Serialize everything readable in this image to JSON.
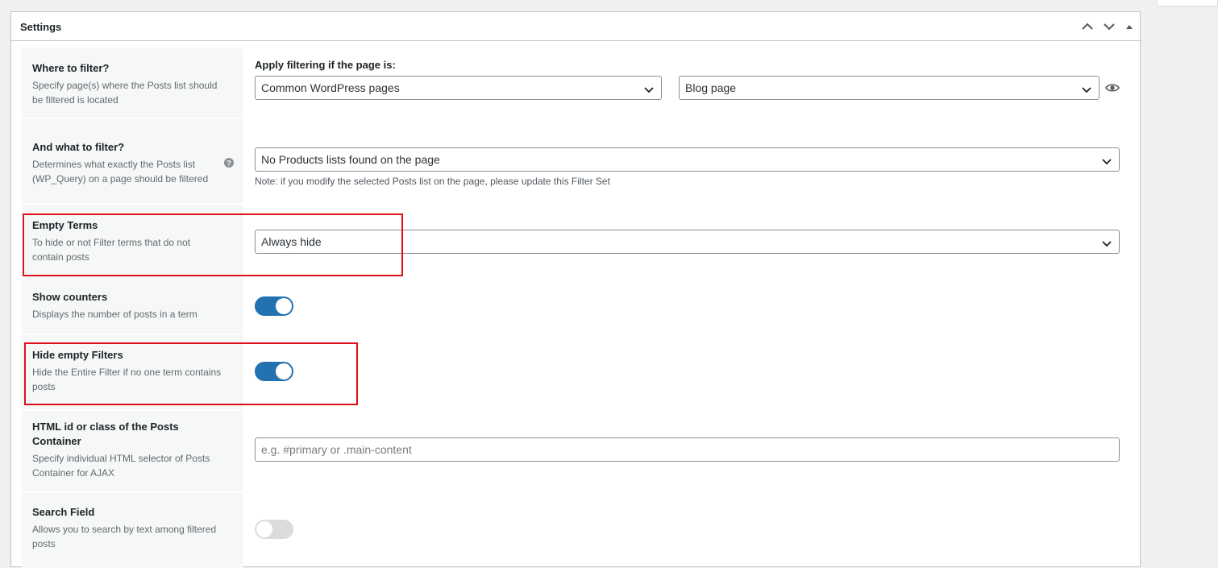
{
  "panel": {
    "title": "Settings",
    "controls": [
      "chevron-up-icon",
      "chevron-down-icon",
      "triangle-up-icon"
    ]
  },
  "where_to_filter": {
    "title": "Where to filter?",
    "description": "Specify page(s) where the Posts list should be filtered is located",
    "apply_label": "Apply filtering if the page is:",
    "page_type_value": "Common WordPress pages",
    "page_value": "Blog page"
  },
  "what_to_filter": {
    "title": "And what to filter?",
    "description": "Determines what exactly the Posts list (WP_Query) on a page should be filtered",
    "select_value": "No Products lists found on the page",
    "note": "Note: if you modify the selected Posts list on the page, please update this Filter Set"
  },
  "empty_terms": {
    "title": "Empty Terms",
    "description": "To hide or not Filter terms that do not contain posts",
    "select_value": "Always hide"
  },
  "show_counters": {
    "title": "Show counters",
    "description": "Displays the number of posts in a term",
    "enabled": true
  },
  "hide_empty_filters": {
    "title": "Hide empty Filters",
    "description": "Hide the Entire Filter if no one term contains posts",
    "enabled": true
  },
  "posts_container": {
    "title": "HTML id or class of the Posts Container",
    "description": "Specify individual HTML selector of Posts Container for AJAX",
    "value": "",
    "placeholder": "e.g. #primary or .main-content"
  },
  "search_field": {
    "title": "Search Field",
    "description": "Allows you to search by text among filtered posts",
    "enabled": false
  },
  "colors": {
    "accent": "#2271b1",
    "highlight": "#e0101b",
    "toggle_off": "#dcdcde"
  }
}
